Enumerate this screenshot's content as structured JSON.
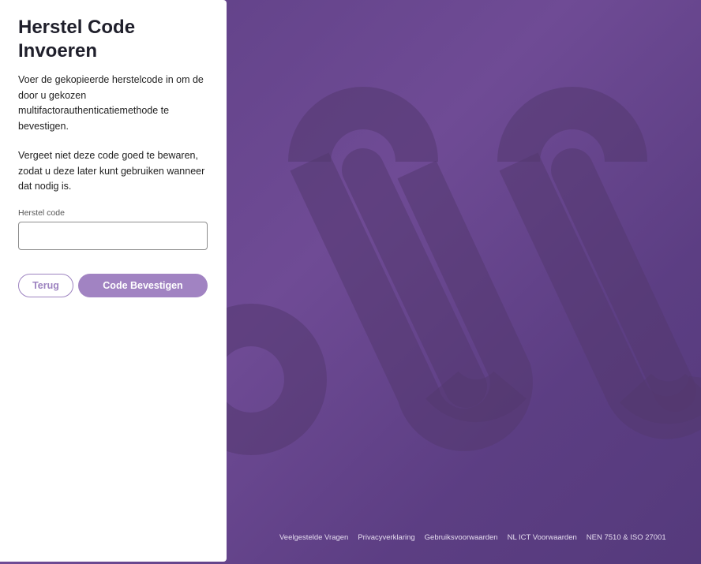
{
  "form": {
    "title": "Herstel Code Invoeren",
    "paragraph_1": "Voer de gekopieerde herstelcode in om de door u gekozen multifactorauthenticatiemethode te bevestigen.",
    "paragraph_2": "Vergeet niet deze code goed te bewaren, zodat u deze later kunt gebruiken wanneer dat nodig is.",
    "field_label": "Herstel code",
    "field_value": "",
    "back_label": "Terug",
    "confirm_label": "Code Bevestigen"
  },
  "footer": {
    "links": [
      "Veelgestelde Vragen",
      "Privacyverklaring",
      "Gebruiksvoorwaarden",
      "NL ICT Voorwaarden",
      "NEN 7510 & ISO 27001"
    ]
  },
  "colors": {
    "background": "#6a4792",
    "accent": "#a183c2",
    "panel": "#ffffff"
  }
}
